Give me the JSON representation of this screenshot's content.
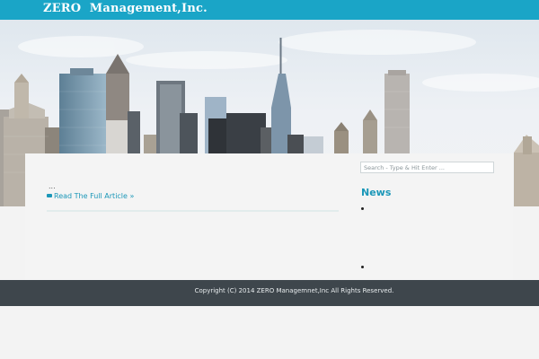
{
  "site": {
    "title": "ZERO  Management,Inc."
  },
  "post": {
    "excerpt": "...",
    "read_more": "Read The Full Article »"
  },
  "sidebar": {
    "search_placeholder": "Search - Type & Hit Enter ...",
    "news_title": "News",
    "news_items": [
      "",
      ""
    ]
  },
  "footer": {
    "copyright": "Copyright (C) 2014 ZERO Managemnet,Inc All Rights Reserved."
  },
  "colors": {
    "accent": "#1aa5c7",
    "footer_bg": "#3e464c",
    "link": "#1b97b8",
    "page_bg": "#f3f3f3"
  },
  "icons": {
    "read_more": "folder-icon"
  }
}
